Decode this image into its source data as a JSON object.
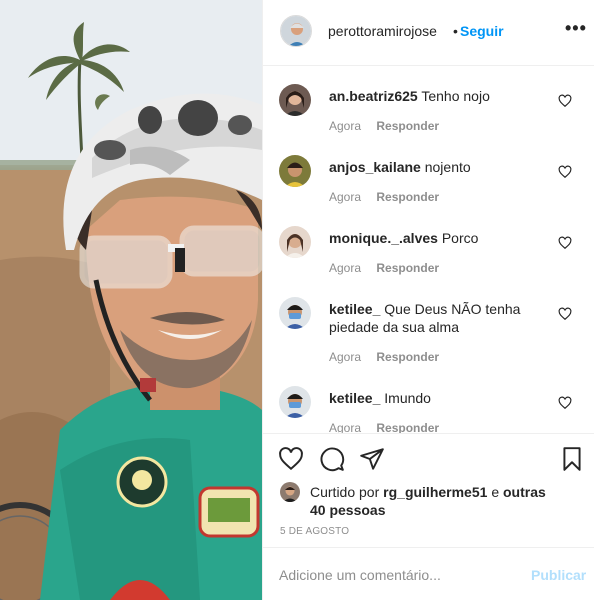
{
  "post": {
    "username": "perottoramirojose",
    "dot": "•",
    "follow_label": "Seguir",
    "more_label": "•••"
  },
  "comments": [
    {
      "username": "an.beatriz625",
      "text": "Tenho nojo",
      "time": "Agora",
      "reply_label": "Responder"
    },
    {
      "username": "anjos_kailane",
      "text": "nojento",
      "time": "Agora",
      "reply_label": "Responder"
    },
    {
      "username": "monique._.alves",
      "text": "Porco",
      "time": "Agora",
      "reply_label": "Responder"
    },
    {
      "username": "ketilee_",
      "text": "Que Deus NÃO tenha piedade da sua alma",
      "time": "Agora",
      "reply_label": "Responder"
    },
    {
      "username": "ketilee_",
      "text": "Imundo",
      "time": "Agora",
      "reply_label": "Responder"
    }
  ],
  "likes": {
    "prefix": "Curtido por",
    "user": "rg_guilherme51",
    "connector": "e",
    "others": "outras 40 pessoas"
  },
  "date": "5 DE AGOSTO",
  "add_comment": {
    "placeholder": "Adicione um comentário...",
    "publish_label": "Publicar"
  },
  "icons": {
    "like": "heart-icon",
    "comment": "comment-icon",
    "share": "share-icon",
    "save": "bookmark-icon",
    "more": "more-options-icon"
  },
  "colors": {
    "link_blue": "#0095f6",
    "publish_disabled": "#b2dffc",
    "meta_gray": "#8e8e8e",
    "jersey_teal": "#2aa58c"
  }
}
